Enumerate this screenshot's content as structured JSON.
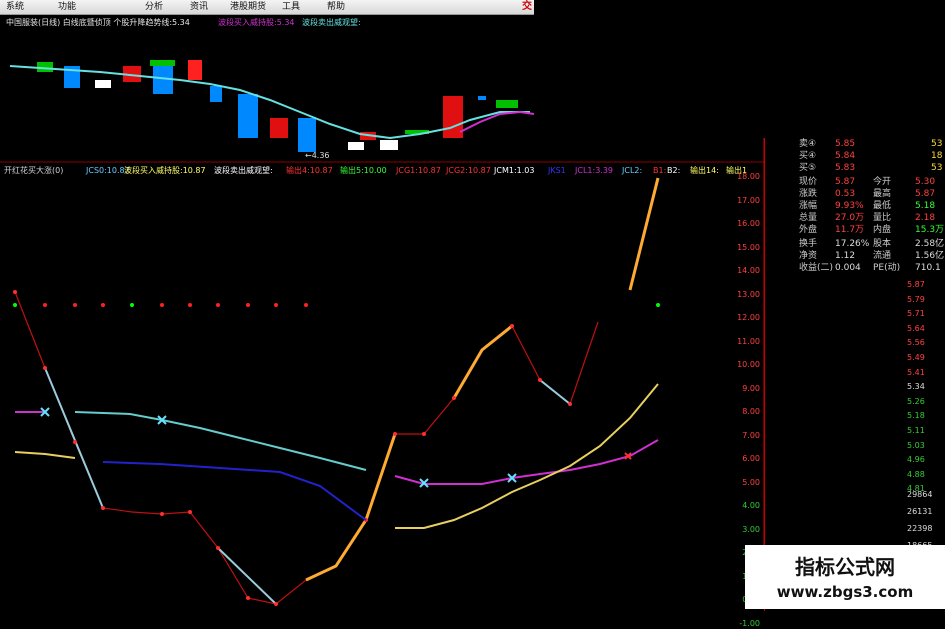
{
  "menu": {
    "items": [
      "系统",
      "功能",
      "分析",
      "资讯",
      "港股期货",
      "工具",
      "帮助"
    ],
    "close": "交"
  },
  "top_panel": {
    "labels": [
      {
        "text": "中国服装(日线) 白线底暨侦顶 个股升降趋势线:5.34",
        "color": "#e6e6e6"
      },
      {
        "text": "波段买入威持股:5.34",
        "color": "#d030d0"
      },
      {
        "text": "波段卖出威观望:",
        "color": "#66e0e0"
      }
    ],
    "annotation": "←4.36"
  },
  "bottom_panel": {
    "labels": [
      {
        "text": "开红花买大涨(0)",
        "color": "#d0d0d0"
      },
      {
        "text": "JCS0:10.87",
        "color": "#66ccff"
      },
      {
        "text": "波段买入威持股:10.87",
        "color": "#ffff66"
      },
      {
        "text": "波段卖出威观望:",
        "color": "#ffffff"
      },
      {
        "text": "输出4:10.87",
        "color": "#ff3333"
      },
      {
        "text": "输出5:10.00",
        "color": "#33ff33"
      },
      {
        "text": "JCG1:10.87",
        "color": "#ff3333"
      },
      {
        "text": "JCG2:10.87",
        "color": "#ff3333"
      },
      {
        "text": "JCM1:1.03",
        "color": "#ffffff"
      },
      {
        "text": "JKS1",
        "color": "#3333ff"
      },
      {
        "text": "JCL1:3.39",
        "color": "#d030d0"
      },
      {
        "text": "JCL2:",
        "color": "#66ccff"
      },
      {
        "text": "B1:",
        "color": "#ff3333"
      },
      {
        "text": "B2:",
        "color": "#ffffff"
      },
      {
        "text": "输出14:",
        "color": "#ffff66"
      },
      {
        "text": "输出1",
        "color": "#ffff66"
      }
    ]
  },
  "right_axis": [
    "18.00",
    "17.00",
    "16.00",
    "15.00",
    "14.00",
    "13.00",
    "12.00",
    "11.00",
    "10.00",
    "9.00",
    "8.00",
    "7.00",
    "6.00",
    "5.00",
    "4.00",
    "3.00",
    "2.00",
    "1.00",
    "0.00",
    "-1.00"
  ],
  "quote": {
    "rows": [
      {
        "label": "卖④",
        "value": "5.85",
        "extra": "53"
      },
      {
        "label": "买④",
        "value": "5.84",
        "extra": "18"
      },
      {
        "label": "买⑤",
        "value": "5.83",
        "extra": "53"
      },
      {
        "label": "现价",
        "value": "5.87",
        "label2": "今开",
        "value2": "5.30"
      },
      {
        "label": "涨跌",
        "value": "0.53",
        "label2": "最高",
        "value2": "5.87"
      },
      {
        "label": "涨幅",
        "value": "9.93%",
        "label2": "最低",
        "value2": "5.18"
      },
      {
        "label": "总量",
        "value": "27.0万",
        "label2": "量比",
        "value2": "2.18"
      },
      {
        "label": "外盘",
        "value": "11.7万",
        "label2": "内盘",
        "value2": "15.3万"
      },
      {
        "label": "换手",
        "value": "17.26%",
        "label2": "股本",
        "value2": "2.58亿"
      },
      {
        "label": "净资",
        "value": "1.12",
        "label2": "流通",
        "value2": "1.56亿"
      },
      {
        "label": "收益(二)",
        "value": "0.004",
        "label2": "PE(动)",
        "value2": "710.1"
      }
    ],
    "intraday_axis": [
      "5.87",
      "5.79",
      "5.71",
      "5.64",
      "5.56",
      "5.49",
      "5.41",
      "5.34",
      "5.26",
      "5.18",
      "5.11",
      "5.03",
      "4.96",
      "4.88",
      "4.81"
    ],
    "volume_axis": [
      "29864",
      "26131",
      "22398",
      "18665"
    ]
  },
  "watermark": {
    "line1": "指标公式网",
    "line2": "www.zbgs3.com"
  }
}
